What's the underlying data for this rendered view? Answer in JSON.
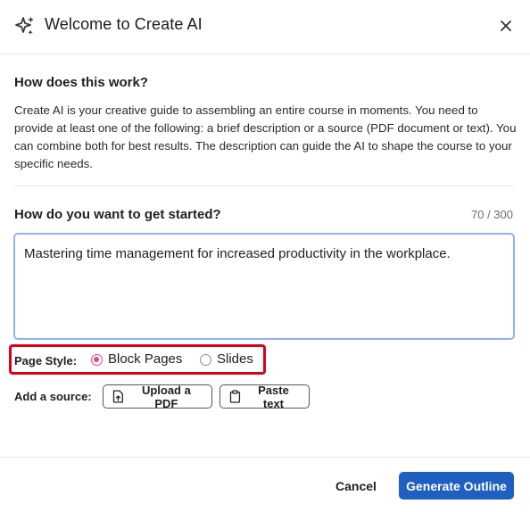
{
  "dialog": {
    "title": "Welcome to Create AI",
    "icon": "sparkle-icon"
  },
  "intro": {
    "heading": "How does this work?",
    "description": "Create AI is your creative guide to assembling an entire course in moments. You need to provide at least one of the following: a brief description or a source (PDF document or text). You can combine both for best results. The description can guide the AI to shape the course to your specific needs."
  },
  "start": {
    "heading": "How do you want to get started?",
    "counter": "70 / 300",
    "input_value": "Mastering time management for increased productivity in the workplace."
  },
  "page_style": {
    "label": "Page Style:",
    "options": [
      {
        "label": "Block Pages",
        "selected": true
      },
      {
        "label": "Slides",
        "selected": false
      }
    ],
    "highlight_color": "#d9001b"
  },
  "source": {
    "label": "Add a source:",
    "upload_label": "Upload a PDF",
    "paste_label": "Paste text"
  },
  "footer": {
    "cancel_label": "Cancel",
    "generate_label": "Generate Outline",
    "accent_color": "#1f5fbf"
  }
}
